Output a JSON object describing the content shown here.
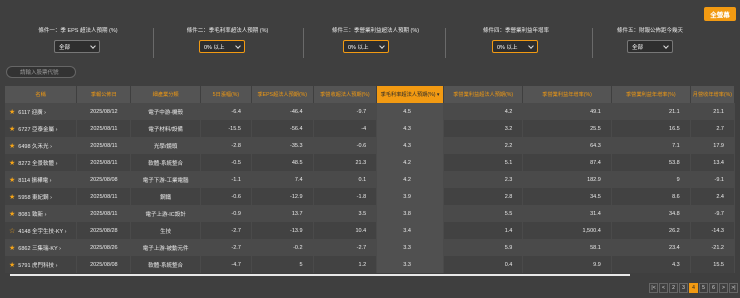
{
  "toolbar": {
    "fullscreen_label": "全螢幕"
  },
  "filters": [
    {
      "label": "條件一：季 EPS 超法人預期 (%)",
      "value": "全部",
      "highlight": false
    },
    {
      "label": "條件二：季毛利率超法人預期 (%)",
      "value": "0% 以上",
      "highlight": true
    },
    {
      "label": "條件三：季營業利益超法人預期 (%)",
      "value": "0% 以上",
      "highlight": true
    },
    {
      "label": "條件四：季營業利益年增率",
      "value": "0% 以上",
      "highlight": true
    },
    {
      "label": "條件五：財報公佈距今幾天",
      "value": "全部",
      "highlight": false
    }
  ],
  "search": {
    "placeholder": "請輸入股票代號"
  },
  "table": {
    "headers": [
      "名稱",
      "季報公佈日",
      "細產業分類",
      "5日漲幅(%)",
      "季EPS超法人預期(%)",
      "季營收超法人預期(%)",
      "季毛利率超法人預期(%)",
      "季營業利益超法人預期(%)",
      "季營業利益年增率(%)",
      "季營業利益年增率(%)",
      "月營收年增率(%)"
    ],
    "sorted_index": 6,
    "rows": [
      [
        "6117 迎廣",
        "2025/08/12",
        "電子中游-機殼",
        "-6.4",
        "-46.4",
        "-9.7",
        "4.5",
        "4.2",
        "49.1",
        "21.1",
        "21.1"
      ],
      [
        "6727 亞泰金屬",
        "2025/08/11",
        "電子材料/設備",
        "-15.5",
        "-56.4",
        "-4",
        "4.3",
        "3.2",
        "25.5",
        "16.5",
        "2.7"
      ],
      [
        "6498 久禾光",
        "2025/08/11",
        "光學/鏡頭",
        "-2.8",
        "-35.3",
        "-0.6",
        "4.3",
        "2.2",
        "64.3",
        "7.1",
        "17.9"
      ],
      [
        "8272 全景軟體",
        "2025/08/11",
        "軟體-系統整合",
        "-0.5",
        "48.5",
        "21.3",
        "4.2",
        "5.1",
        "87.4",
        "53.8",
        "13.4"
      ],
      [
        "8114 振樺電",
        "2025/08/08",
        "電子下游-工業電腦",
        "-1.1",
        "7.4",
        "0.1",
        "4.2",
        "2.3",
        "182.9",
        "9",
        "-9.1"
      ],
      [
        "5958 東紀鋼",
        "2025/08/11",
        "鋼鐵",
        "-0.6",
        "-12.9",
        "-1.8",
        "3.9",
        "2.8",
        "34.5",
        "8.6",
        "2.4"
      ],
      [
        "8081 致新",
        "2025/08/11",
        "電子上游-IC設計",
        "-0.9",
        "13.7",
        "3.5",
        "3.8",
        "5.5",
        "31.4",
        "34.8",
        "-9.7"
      ],
      [
        "4148 全宇生技-KY",
        "2025/08/28",
        "生技",
        "-2.7",
        "-13.9",
        "10.4",
        "3.4",
        "1.4",
        "1,500.4",
        "26.2",
        "-14.3"
      ],
      [
        "6862 三集瑞-KY",
        "2025/08/26",
        "電子上游-被動元件",
        "-2.7",
        "-0.2",
        "-2.7",
        "3.3",
        "5.9",
        "58.1",
        "23.4",
        "-21.2"
      ],
      [
        "5791 虎門科技",
        "2025/08/08",
        "軟體-系統整合",
        "-4.7",
        "5",
        "1.2",
        "3.3",
        "0.4",
        "9.9",
        "4.3",
        "15.5"
      ]
    ],
    "outline_star_row": 7
  },
  "pager": {
    "items": [
      "|<",
      "<",
      "2",
      "3",
      "4",
      "5",
      "6",
      ">",
      ">|"
    ],
    "active": "4"
  },
  "colors": {
    "accent": "#f29a12",
    "background": "#3f3f3f"
  }
}
